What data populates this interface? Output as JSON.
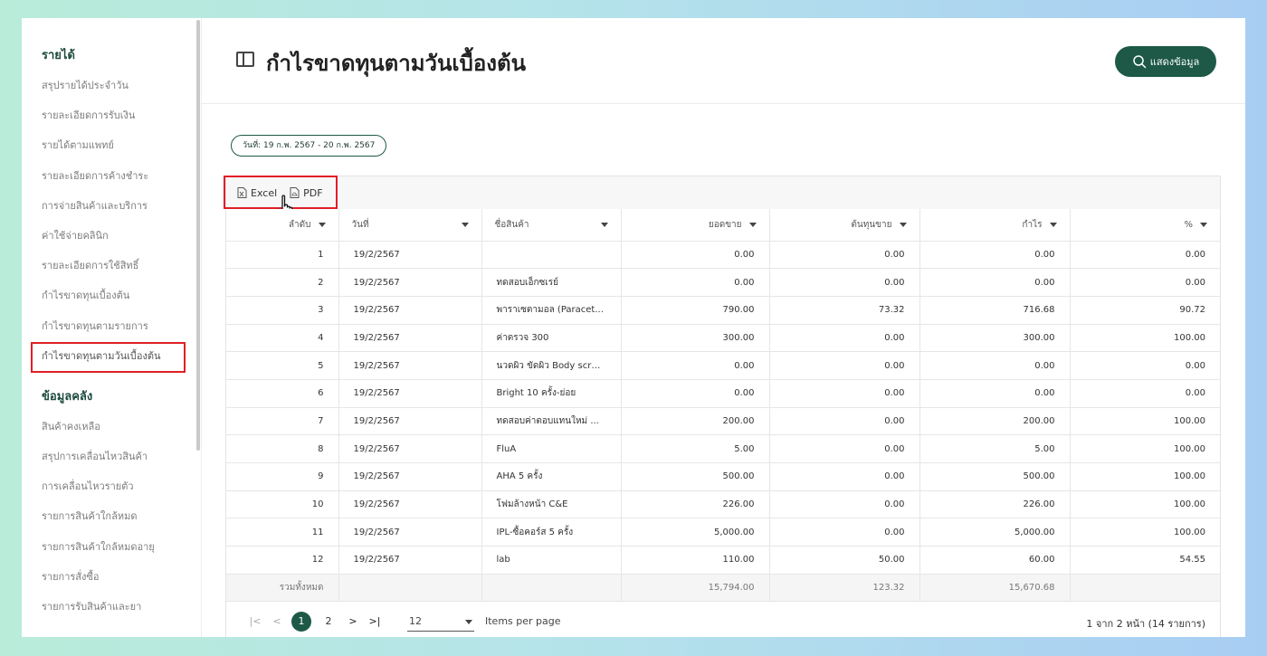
{
  "sidebar": {
    "section1": "รายได้",
    "items1": [
      "สรุปรายได้ประจำวัน",
      "รายละเอียดการรับเงิน",
      "รายได้ตามแพทย์",
      "รายละเอียดการค้างชำระ",
      "การจ่ายสินค้าและบริการ",
      "ค่าใช้จ่ายคลินิก",
      "รายละเอียดการใช้สิทธิ์",
      "กำไรขาดทุนเบื้องต้น",
      "กำไรขาดทุนตามรายการ",
      "กำไรขาดทุนตามวันเบื้องต้น"
    ],
    "section2": "ข้อมูลคลัง",
    "items2": [
      "สินค้าคงเหลือ",
      "สรุปการเคลื่อนไหวสินค้า",
      "การเคลื่อนไหวรายตัว",
      "รายการสินค้าใกล้หมด",
      "รายการสินค้าใกล้หมดอายุ",
      "รายการสั่งซื้อ",
      "รายการรับสินค้าและยา"
    ]
  },
  "header": {
    "title": "กำไรขาดทุนตามวันเบื้องต้น",
    "show_button": "แสดงข้อมูล"
  },
  "date_range": "วันที่: 19 ก.พ. 2567 - 20 ก.พ. 2567",
  "toolbar": {
    "excel": "Excel",
    "pdf": "PDF"
  },
  "table": {
    "headers": [
      "ลำดับ",
      "วันที่",
      "ชื่อสินค้า",
      "ยอดขาย",
      "ต้นทุนขาย",
      "กำไร",
      "%"
    ],
    "rows": [
      [
        "1",
        "19/2/2567",
        "",
        "0.00",
        "0.00",
        "0.00",
        "0.00"
      ],
      [
        "2",
        "19/2/2567",
        "ทดสอบเอ็กซเรย์",
        "0.00",
        "0.00",
        "0.00",
        "0.00"
      ],
      [
        "3",
        "19/2/2567",
        "พาราเซตามอล (Paracet...",
        "790.00",
        "73.32",
        "716.68",
        "90.72"
      ],
      [
        "4",
        "19/2/2567",
        "ค่าตรวจ 300",
        "300.00",
        "0.00",
        "300.00",
        "100.00"
      ],
      [
        "5",
        "19/2/2567",
        "นวดผิว ขัดผิว Body scrub...",
        "0.00",
        "0.00",
        "0.00",
        "0.00"
      ],
      [
        "6",
        "19/2/2567",
        "Bright 10 ครั้ง-ย่อย",
        "0.00",
        "0.00",
        "0.00",
        "0.00"
      ],
      [
        "7",
        "19/2/2567",
        "ทดสอบค่าตอบแทนใหม่ ...",
        "200.00",
        "0.00",
        "200.00",
        "100.00"
      ],
      [
        "8",
        "19/2/2567",
        "FluA",
        "5.00",
        "0.00",
        "5.00",
        "100.00"
      ],
      [
        "9",
        "19/2/2567",
        "AHA 5 ครั้ง",
        "500.00",
        "0.00",
        "500.00",
        "100.00"
      ],
      [
        "10",
        "19/2/2567",
        "โฟมล้างหน้า C&E",
        "226.00",
        "0.00",
        "226.00",
        "100.00"
      ],
      [
        "11",
        "19/2/2567",
        "IPL-ซื้อคอร์ส 5 ครั้ง",
        "5,000.00",
        "0.00",
        "5,000.00",
        "100.00"
      ],
      [
        "12",
        "19/2/2567",
        "lab",
        "110.00",
        "50.00",
        "60.00",
        "54.55"
      ]
    ],
    "total": {
      "label": "รวมทั้งหมด",
      "sales": "15,794.00",
      "cost": "123.32",
      "profit": "15,670.68"
    }
  },
  "pagination": {
    "first": "|<",
    "prev": "<",
    "next": ">",
    "last": ">|",
    "pages": [
      "1",
      "2"
    ],
    "per_page": "12",
    "per_page_label": "Items per page",
    "info": "1 จาก 2 หน้า (14 รายการ)"
  },
  "colors": {
    "brand": "#1d5946",
    "highlight": "#e01f26"
  }
}
